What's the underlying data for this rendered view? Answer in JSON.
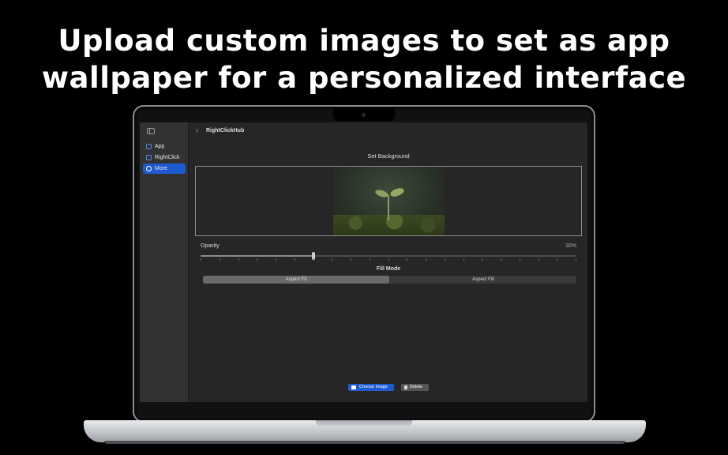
{
  "headline": {
    "line1": "Upload custom images to set as app",
    "line2": "wallpaper for a personalized interface"
  },
  "sidebar": {
    "items": [
      {
        "label": "App",
        "icon": "app-icon"
      },
      {
        "label": "RightClick",
        "icon": "document-icon"
      },
      {
        "label": "More",
        "icon": "more-icon",
        "selected": true
      }
    ]
  },
  "nav": {
    "title": "RightClickHub",
    "back_icon": "chevron-left-icon",
    "back_glyph": "‹"
  },
  "background": {
    "section_title": "Set Background"
  },
  "opacity": {
    "label": "Opacity",
    "value_text": "30%",
    "value": 0.3
  },
  "fill_mode": {
    "title": "Fill Mode",
    "options": [
      "Aspect Fit",
      "Aspect Fill"
    ],
    "selected": "Aspect Fit"
  },
  "buttons": {
    "choose": "Choose Image",
    "delete": "Delete"
  },
  "colors": {
    "accent": "#1e5bd1",
    "screen_bg": "#262626",
    "sidebar_bg": "#323232"
  }
}
